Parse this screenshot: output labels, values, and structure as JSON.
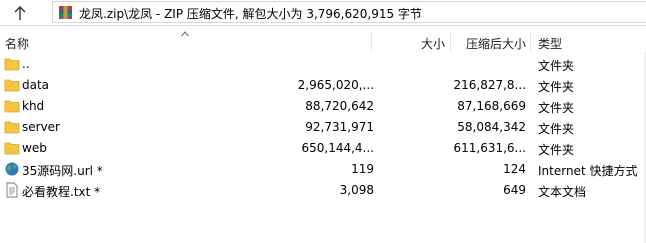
{
  "address": {
    "up_icon": "up-arrow-icon",
    "archive_icon": "winrar-archive-icon",
    "path": "龙凤.zip\\龙凤 - ZIP 压缩文件, 解包大小为 3,796,620,915 字节"
  },
  "columns": {
    "name": "名称",
    "size": "大小",
    "packed": "压缩后大小",
    "type": "类型"
  },
  "rows": [
    {
      "name": "..",
      "size": "",
      "packed": "",
      "type": "文件夹",
      "icon": "folder-icon"
    },
    {
      "name": "data",
      "size": "2,965,020,...",
      "packed": "216,827,8...",
      "type": "文件夹",
      "icon": "folder-icon"
    },
    {
      "name": "khd",
      "size": "88,720,642",
      "packed": "87,168,669",
      "type": "文件夹",
      "icon": "folder-icon"
    },
    {
      "name": "server",
      "size": "92,731,971",
      "packed": "58,084,342",
      "type": "文件夹",
      "icon": "folder-icon"
    },
    {
      "name": "web",
      "size": "650,144,4...",
      "packed": "611,631,6...",
      "type": "文件夹",
      "icon": "folder-icon"
    },
    {
      "name": "35源码网.url *",
      "size": "119",
      "packed": "124",
      "type": "Internet 快捷方式",
      "icon": "globe-icon"
    },
    {
      "name": "必看教程.txt *",
      "size": "3,098",
      "packed": "649",
      "type": "文本文档",
      "icon": "text-file-icon"
    }
  ]
}
